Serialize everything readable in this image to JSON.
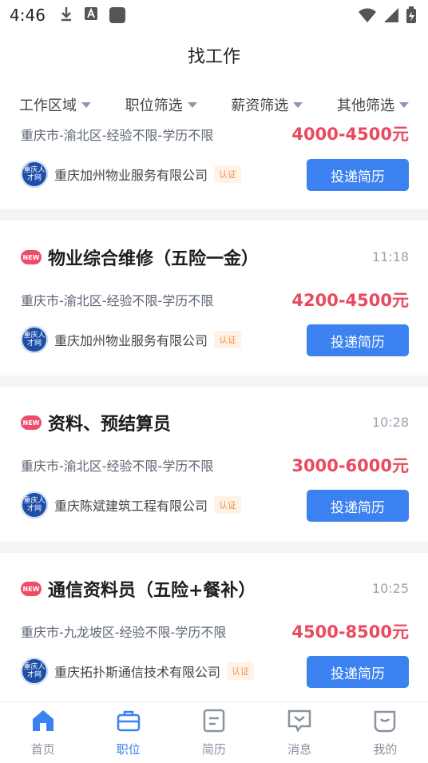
{
  "status": {
    "time": "4:46"
  },
  "header": {
    "title": "找工作"
  },
  "filters": [
    "工作区域",
    "职位筛选",
    "薪资筛选",
    "其他筛选"
  ],
  "jobs": [
    {
      "title": "",
      "time": "",
      "meta": "重庆市-渝北区-经验不限-学历不限",
      "salary": "4000-4500元",
      "company": "重庆加州物业服务有限公司",
      "cert": "认证",
      "apply": "投递简历",
      "partial": true
    },
    {
      "title": "物业综合维修（五险一金）",
      "time": "11:18",
      "meta": "重庆市-渝北区-经验不限-学历不限",
      "salary": "4200-4500元",
      "company": "重庆加州物业服务有限公司",
      "cert": "认证",
      "apply": "投递简历"
    },
    {
      "title": "资料、预结算员",
      "time": "10:28",
      "meta": "重庆市-渝北区-经验不限-学历不限",
      "salary": "3000-6000元",
      "company": "重庆陈斌建筑工程有限公司",
      "cert": "认证",
      "apply": "投递简历"
    },
    {
      "title": "通信资料员（五险+餐补）",
      "time": "10:25",
      "meta": "重庆市-九龙坡区-经验不限-学历不限",
      "salary": "4500-8500元",
      "company": "重庆拓扑斯通信技术有限公司",
      "cert": "认证",
      "apply": "投递简历"
    }
  ],
  "new_badge": "NEW",
  "logo_text": "重庆人才网",
  "tabs": [
    {
      "label": "首页",
      "icon": "home-icon",
      "active": false
    },
    {
      "label": "职位",
      "icon": "briefcase-icon",
      "active": true
    },
    {
      "label": "简历",
      "icon": "resume-icon",
      "active": false
    },
    {
      "label": "消息",
      "icon": "message-icon",
      "active": false
    },
    {
      "label": "我的",
      "icon": "profile-icon",
      "active": false
    }
  ],
  "colors": {
    "accent": "#3b82f0",
    "salary": "#e84a5f",
    "badge": "#ee4d6a"
  }
}
